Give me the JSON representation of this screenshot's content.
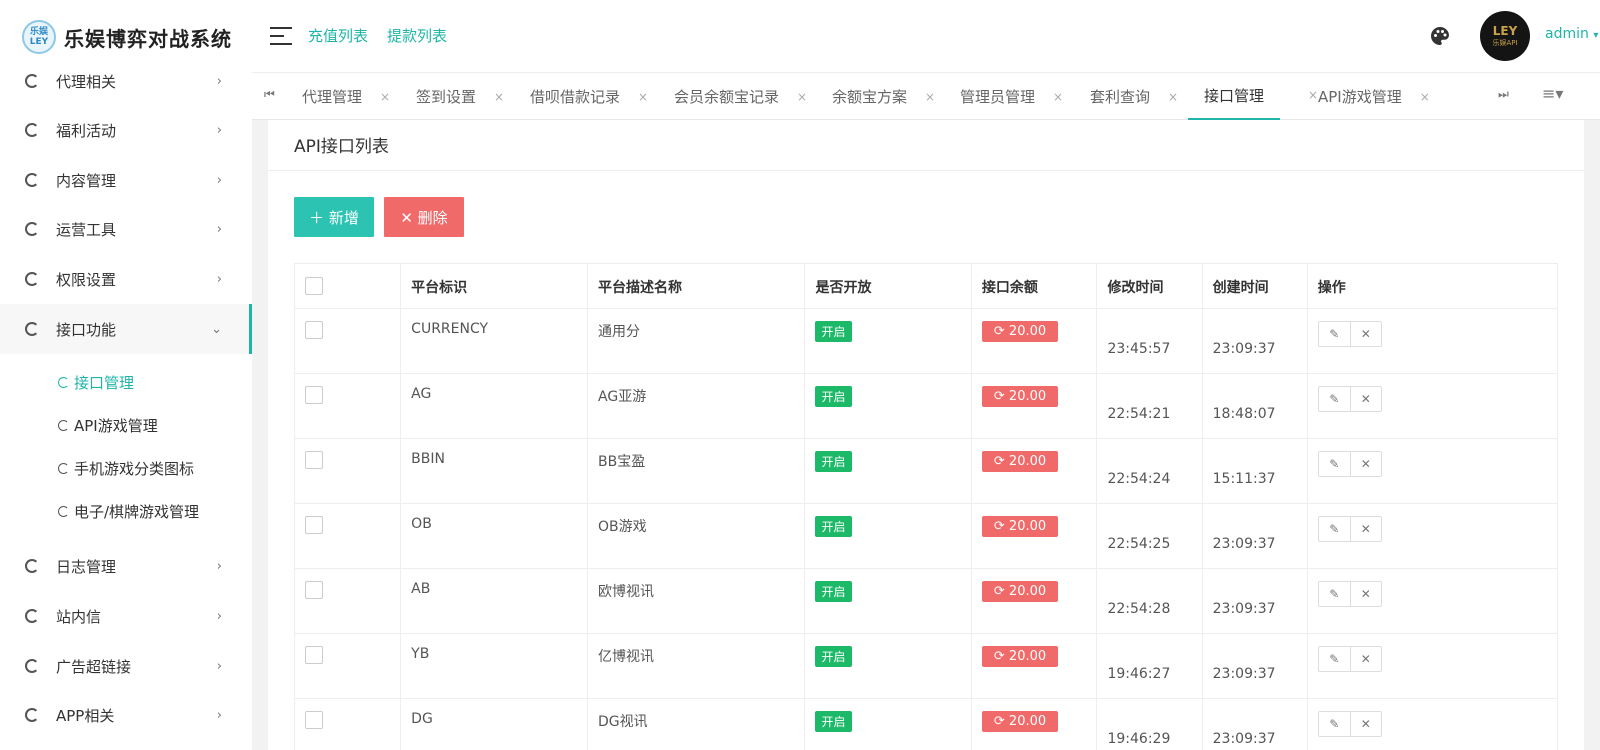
{
  "header": {
    "logo_badge": "乐娱 LEY",
    "app_title": "乐娱博弈对战系统",
    "links": [
      "充值列表",
      "提款列表"
    ],
    "user": "admin",
    "avatar_text": "LEY",
    "avatar_sub": "乐娱API"
  },
  "sidebar": {
    "items": [
      {
        "label": "代理相关"
      },
      {
        "label": "福利活动"
      },
      {
        "label": "内容管理"
      },
      {
        "label": "运营工具"
      },
      {
        "label": "权限设置"
      },
      {
        "label": "接口功能"
      },
      {
        "label": "日志管理"
      },
      {
        "label": "站内信"
      },
      {
        "label": "广告超链接"
      },
      {
        "label": "APP相关"
      }
    ],
    "subitems": [
      {
        "label": "接口管理"
      },
      {
        "label": "API游戏管理"
      },
      {
        "label": "手机游戏分类图标"
      },
      {
        "label": "电子/棋牌游戏管理"
      }
    ]
  },
  "tabs": [
    {
      "label": "代理管理"
    },
    {
      "label": "签到设置"
    },
    {
      "label": "借呗借款记录"
    },
    {
      "label": "会员余额宝记录"
    },
    {
      "label": "余额宝方案"
    },
    {
      "label": "管理员管理"
    },
    {
      "label": "套利查询"
    },
    {
      "label": "接口管理"
    },
    {
      "label": "API游戏管理"
    }
  ],
  "page": {
    "title": "API接口列表",
    "add_label": "＋ 新增",
    "delete_label": "✕ 删除"
  },
  "table": {
    "headers": [
      "平台标识",
      "平台描述名称",
      "是否开放",
      "接口余额",
      "修改时间",
      "创建时间",
      "操作"
    ],
    "rows": [
      {
        "code": "CURRENCY",
        "name": "通用分",
        "status": "开启",
        "balance": "⟳ 20.00",
        "modified": "23:45:57",
        "created": "23:09:37"
      },
      {
        "code": "AG",
        "name": "AG亚游",
        "status": "开启",
        "balance": "⟳ 20.00",
        "modified": "22:54:21",
        "created": "18:48:07"
      },
      {
        "code": "BBIN",
        "name": "BB宝盈",
        "status": "开启",
        "balance": "⟳ 20.00",
        "modified": "22:54:24",
        "created": "15:11:37"
      },
      {
        "code": "OB",
        "name": "OB游戏",
        "status": "开启",
        "balance": "⟳ 20.00",
        "modified": "22:54:25",
        "created": "23:09:37"
      },
      {
        "code": "AB",
        "name": "欧博视讯",
        "status": "开启",
        "balance": "⟳ 20.00",
        "modified": "22:54:28",
        "created": "23:09:37"
      },
      {
        "code": "YB",
        "name": "亿博视讯",
        "status": "开启",
        "balance": "⟳ 20.00",
        "modified": "19:46:27",
        "created": "23:09:37"
      },
      {
        "code": "DG",
        "name": "DG视讯",
        "status": "开启",
        "balance": "⟳ 20.00",
        "modified": "19:46:29",
        "created": "23:09:37"
      }
    ]
  },
  "colors": {
    "accent": "#1fb5a8",
    "danger": "#f16a6a",
    "success": "#1cb968"
  }
}
